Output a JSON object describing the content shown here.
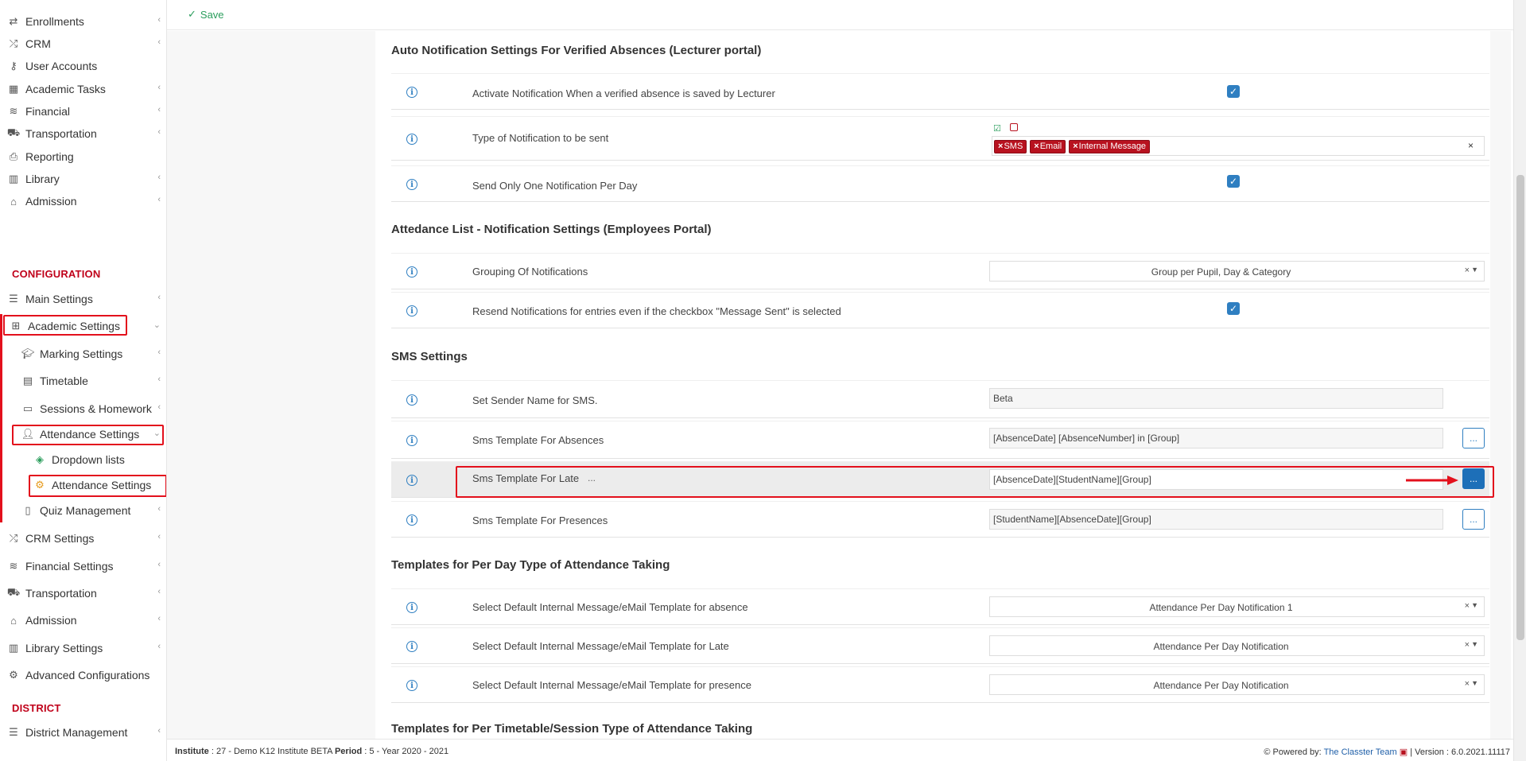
{
  "sidebar": {
    "items": [
      {
        "label": "Enrollments",
        "icon": "exchange-icon",
        "chev": "‹"
      },
      {
        "label": "CRM",
        "icon": "shuffle-icon",
        "chev": "‹"
      },
      {
        "label": "User Accounts",
        "icon": "key-icon",
        "chev": ""
      },
      {
        "label": "Academic Tasks",
        "icon": "grid-icon",
        "chev": "‹"
      },
      {
        "label": "Financial",
        "icon": "coins-icon",
        "chev": "‹"
      },
      {
        "label": "Transportation",
        "icon": "bus-icon",
        "chev": "‹"
      },
      {
        "label": "Reporting",
        "icon": "printer-icon",
        "chev": ""
      },
      {
        "label": "Library",
        "icon": "books-icon",
        "chev": "‹"
      },
      {
        "label": "Admission",
        "icon": "institution-icon",
        "chev": "‹"
      }
    ],
    "configuration_label": "CONFIGURATION",
    "config_items": [
      {
        "label": "Main Settings",
        "icon": "sliders-icon",
        "chev": "‹"
      },
      {
        "label": "Academic Settings",
        "icon": "sitemap-icon",
        "chev": "⌄"
      },
      {
        "label": "Marking Settings",
        "icon": "graduation-cap-icon",
        "chev": "‹"
      },
      {
        "label": "Timetable",
        "icon": "calendar-icon",
        "chev": "‹"
      },
      {
        "label": "Sessions & Homework",
        "icon": "clipboard-icon",
        "chev": "‹"
      },
      {
        "label": "Attendance Settings",
        "icon": "user-check-icon",
        "chev": "⌄"
      },
      {
        "label": "Dropdown lists",
        "icon": "layers-icon",
        "chev": ""
      },
      {
        "label": "Attendance Settings",
        "icon": "cogs-icon",
        "chev": ""
      },
      {
        "label": "Quiz Management",
        "icon": "book-icon",
        "chev": "‹"
      },
      {
        "label": "CRM Settings",
        "icon": "shuffle-icon",
        "chev": "‹"
      },
      {
        "label": "Financial Settings",
        "icon": "coins-icon",
        "chev": "‹"
      },
      {
        "label": "Transportation",
        "icon": "bus-icon",
        "chev": "‹"
      },
      {
        "label": "Admission",
        "icon": "institution-icon",
        "chev": "‹"
      },
      {
        "label": "Library Settings",
        "icon": "books-icon",
        "chev": "‹"
      },
      {
        "label": "Advanced Configurations",
        "icon": "cogs-icon",
        "chev": ""
      }
    ],
    "district_label": "DISTRICT",
    "district_items": [
      {
        "label": "District Management",
        "icon": "list-icon",
        "chev": "‹"
      }
    ]
  },
  "toolbar": {
    "save_label": "Save"
  },
  "sections": {
    "s1": "Auto Notification Settings For Verified Absences (Lecturer portal)",
    "s2": "Attedance List - Notification Settings (Employees Portal)",
    "s3": "SMS Settings",
    "s4": "Templates for Per Day Type of Attendance Taking",
    "s5": "Templates for Per Timetable/Session Type of Attendance Taking"
  },
  "rows": {
    "activate": {
      "label": "Activate Notification When a verified absence is saved by Lecturer",
      "checked": true
    },
    "type": {
      "label": "Type of Notification to be sent",
      "tags": [
        "SMS",
        "Email",
        "Internal Message"
      ],
      "clear": "×"
    },
    "one_per_day": {
      "label": "Send Only One Notification Per Day",
      "checked": true
    },
    "grouping": {
      "label": "Grouping Of Notifications",
      "value": "Group per Pupil, Day & Category"
    },
    "resend": {
      "label": "Resend Notifications for entries even if the checkbox \"Message Sent\" is selected",
      "checked": true
    },
    "sender": {
      "label": "Set Sender Name for SMS.",
      "value": "Beta"
    },
    "tpl_absences": {
      "label": "Sms Template For Absences",
      "value": "[AbsenceDate] [AbsenceNumber] in [Group]"
    },
    "tpl_late": {
      "label": "Sms Template For Late",
      "value": "[AbsenceDate][StudentName][Group]",
      "ellipsis": "..."
    },
    "tpl_presences": {
      "label": "Sms Template For Presences",
      "value": "[StudentName][AbsenceDate][Group]"
    },
    "im_absence": {
      "label": "Select Default Internal Message/eMail Template for absence",
      "value": "Attendance Per Day Notification 1"
    },
    "im_late": {
      "label": "Select Default Internal Message/eMail Template for Late",
      "value": "Attendance Per Day Notification"
    },
    "im_presence": {
      "label": "Select Default Internal Message/eMail Template for presence",
      "value": "Attendance Per Day Notification"
    }
  },
  "dots_label": "...",
  "footer": {
    "institute_label": "Institute",
    "institute_value": ": 27 - Demo K12 Institute BETA",
    "period_label": "Period",
    "period_value": ": 5 - Year 2020 - 2021",
    "powered_by": "Powered by:",
    "team": "The Classter Team",
    "version": "| Version : 6.0.2021.11117"
  },
  "colors": {
    "accent": "#2f7fc1",
    "highlight": "#e3101c",
    "tag": "#b8121f",
    "save": "#2a9d5c"
  }
}
